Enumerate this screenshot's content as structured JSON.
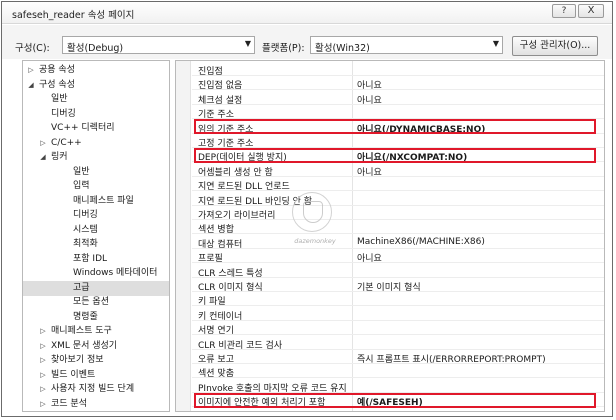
{
  "window": {
    "title": "safeseh_reader 속성 페이지",
    "help_label": "?",
    "close_label": "X"
  },
  "toolbar": {
    "config_label": "구성(C):",
    "config_value": "활성(Debug)",
    "platform_label": "플랫폼(P):",
    "platform_value": "활성(Win32)",
    "config_manager_label": "구성 관리자(O)..."
  },
  "tree": {
    "items": [
      {
        "label": "공용 속성",
        "expander": "collapsed",
        "level": 0
      },
      {
        "label": "구성 속성",
        "expander": "expanded",
        "level": 0
      },
      {
        "label": "일반",
        "expander": "none",
        "level": 1
      },
      {
        "label": "디버깅",
        "expander": "none",
        "level": 1
      },
      {
        "label": "VC++ 디렉터리",
        "expander": "none",
        "level": 1
      },
      {
        "label": "C/C++",
        "expander": "collapsed",
        "level": 1
      },
      {
        "label": "링커",
        "expander": "expanded",
        "level": 1
      },
      {
        "label": "일반",
        "expander": "none",
        "level": 2
      },
      {
        "label": "입력",
        "expander": "none",
        "level": 2
      },
      {
        "label": "매니페스트 파일",
        "expander": "none",
        "level": 2
      },
      {
        "label": "디버깅",
        "expander": "none",
        "level": 2
      },
      {
        "label": "시스템",
        "expander": "none",
        "level": 2
      },
      {
        "label": "최적화",
        "expander": "none",
        "level": 2
      },
      {
        "label": "포함 IDL",
        "expander": "none",
        "level": 2
      },
      {
        "label": "Windows 메타데이터",
        "expander": "none",
        "level": 2
      },
      {
        "label": "고급",
        "expander": "none",
        "level": 2,
        "selected": true
      },
      {
        "label": "모든 옵션",
        "expander": "none",
        "level": 2
      },
      {
        "label": "명령줄",
        "expander": "none",
        "level": 2
      },
      {
        "label": "매니페스트 도구",
        "expander": "collapsed",
        "level": 1
      },
      {
        "label": "XML 문서 생성기",
        "expander": "collapsed",
        "level": 1
      },
      {
        "label": "찾아보기 정보",
        "expander": "collapsed",
        "level": 1
      },
      {
        "label": "빌드 이벤트",
        "expander": "collapsed",
        "level": 1
      },
      {
        "label": "사용자 지정 빌드 단계",
        "expander": "collapsed",
        "level": 1
      },
      {
        "label": "코드 분석",
        "expander": "collapsed",
        "level": 1
      }
    ]
  },
  "properties": {
    "rows": [
      {
        "name": "진입점",
        "value": "",
        "highlight": false
      },
      {
        "name": "진입점 없음",
        "value": "아니요",
        "highlight": false
      },
      {
        "name": "체크섬 설정",
        "value": "아니요",
        "highlight": false
      },
      {
        "name": "기준 주소",
        "value": "",
        "highlight": false
      },
      {
        "name": "임의 기준 주소",
        "value": "아니요(/DYNAMICBASE:NO)",
        "highlight": true
      },
      {
        "name": "고정 기준 주소",
        "value": "",
        "highlight": false
      },
      {
        "name": "DEP(데이터 실행 방지)",
        "value": "아니요(/NXCOMPAT:NO)",
        "highlight": true
      },
      {
        "name": "어셈블리 생성 안 함",
        "value": "아니요",
        "highlight": false
      },
      {
        "name": "지연 로드된 DLL 언로드",
        "value": "",
        "highlight": false
      },
      {
        "name": "지연 로드된 DLL 바인딩 안 함",
        "value": "",
        "highlight": false
      },
      {
        "name": "가져오기 라이브러리",
        "value": "",
        "highlight": false
      },
      {
        "name": "섹션 병합",
        "value": "",
        "highlight": false
      },
      {
        "name": "대상 컴퓨터",
        "value": "MachineX86(/MACHINE:X86)",
        "highlight": false
      },
      {
        "name": "프로필",
        "value": "아니요",
        "highlight": false
      },
      {
        "name": "CLR 스레드 특성",
        "value": "",
        "highlight": false
      },
      {
        "name": "CLR 이미지 형식",
        "value": "기본 이미지 형식",
        "highlight": false
      },
      {
        "name": "키 파일",
        "value": "",
        "highlight": false
      },
      {
        "name": "키 컨테이너",
        "value": "",
        "highlight": false
      },
      {
        "name": "서명 연기",
        "value": "",
        "highlight": false
      },
      {
        "name": "CLR 비관리 코드 검사",
        "value": "",
        "highlight": false
      },
      {
        "name": "오류 보고",
        "value": "즉시 프롬프트 표시(/ERRORREPORT:PROMPT)",
        "highlight": false
      },
      {
        "name": "섹션 맞춤",
        "value": "",
        "highlight": false
      },
      {
        "name": "PInvoke 호출의 마지막 오류 코드 유지",
        "value": "",
        "highlight": false
      },
      {
        "name": "이미지에 안전한 예외 처리기 포함",
        "value": "예(/SAFESEH)",
        "highlight": true
      }
    ]
  },
  "watermark": {
    "text": "dazemonkey"
  },
  "colors": {
    "highlight_border": "#e0182a",
    "selected_tree_item": "#dedede"
  }
}
